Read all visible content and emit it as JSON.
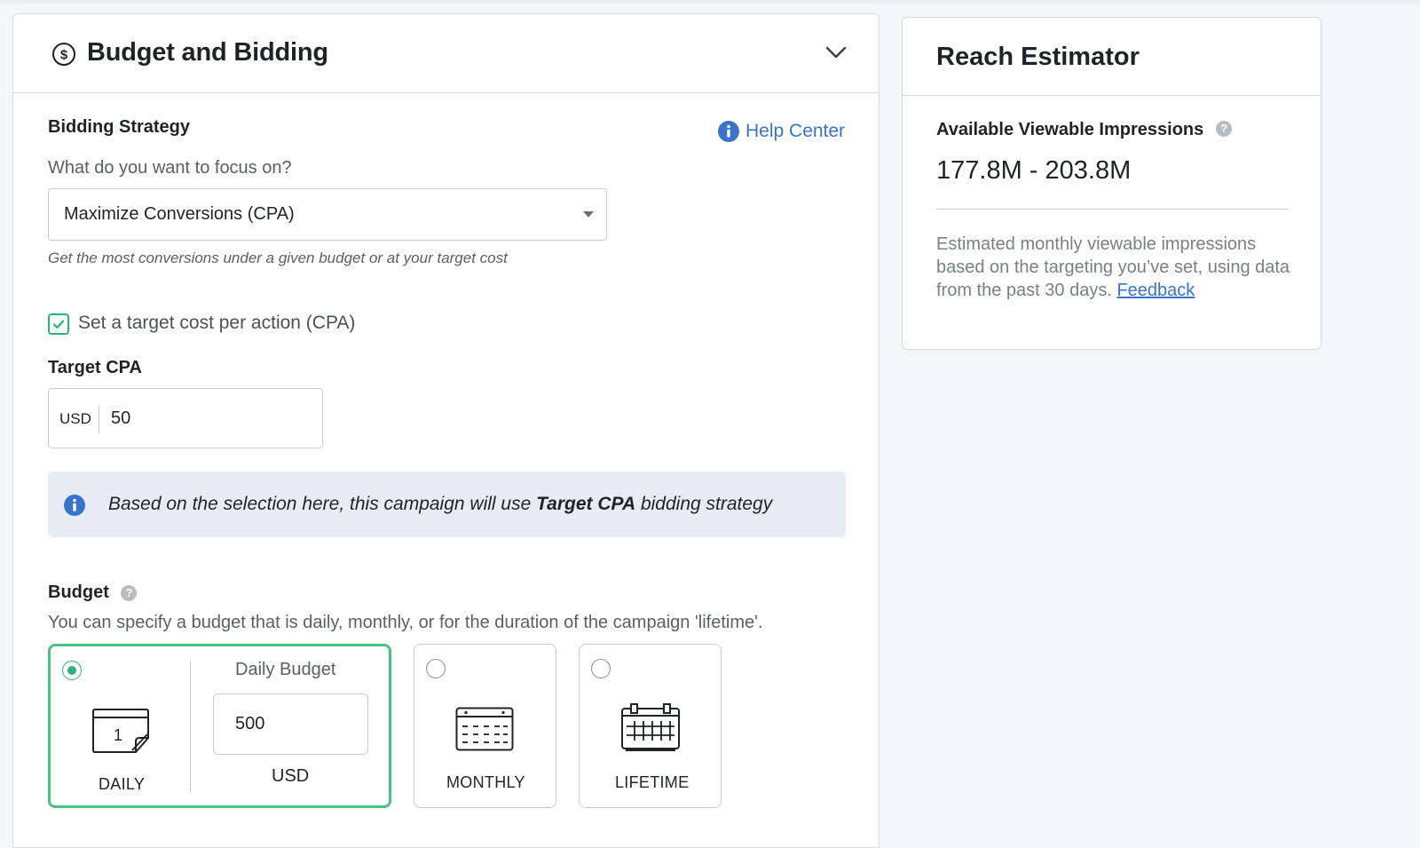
{
  "budget_panel": {
    "title": "Budget and Bidding",
    "bidding": {
      "heading": "Bidding Strategy",
      "help_link": "Help Center",
      "question": "What do you want to focus on?",
      "selected_strategy": "Maximize Conversions (CPA)",
      "hint": "Get the most conversions under a given budget or at your target cost"
    },
    "target_cpa_checkbox": {
      "label": "Set a target cost per action (CPA)",
      "checked": true
    },
    "target_cpa": {
      "heading": "Target CPA",
      "currency": "USD",
      "value": "50"
    },
    "info_banner": {
      "prefix": "Based on the selection here, this campaign will use ",
      "strategy": "Target CPA",
      "suffix": " bidding strategy"
    },
    "budget": {
      "heading": "Budget",
      "help_icon_glyph": "?",
      "description": "You can specify a budget that is daily, monthly, or for the duration of the campaign 'lifetime'.",
      "options": [
        {
          "caption": "DAILY",
          "icon": "calendar-day-icon",
          "calendar_day": "1",
          "selected": true
        },
        {
          "caption": "MONTHLY",
          "icon": "calendar-month-icon",
          "selected": false
        },
        {
          "caption": "LIFETIME",
          "icon": "calendar-lifetime-icon",
          "selected": false
        }
      ],
      "daily_budget_label": "Daily Budget",
      "daily_budget_value": "500",
      "daily_budget_currency": "USD"
    }
  },
  "reach_estimator": {
    "title": "Reach Estimator",
    "metric_label": "Available Viewable Impressions",
    "help_icon_glyph": "?",
    "range": "177.8M - 203.8M",
    "description": "Estimated monthly viewable impressions based on the targeting you’ve set, using data from the past 30 days.",
    "feedback_link": "Feedback"
  },
  "colors": {
    "accent_green": "#2fb277",
    "link_blue": "#3a74c8",
    "info_bg": "#e7ecf7"
  }
}
